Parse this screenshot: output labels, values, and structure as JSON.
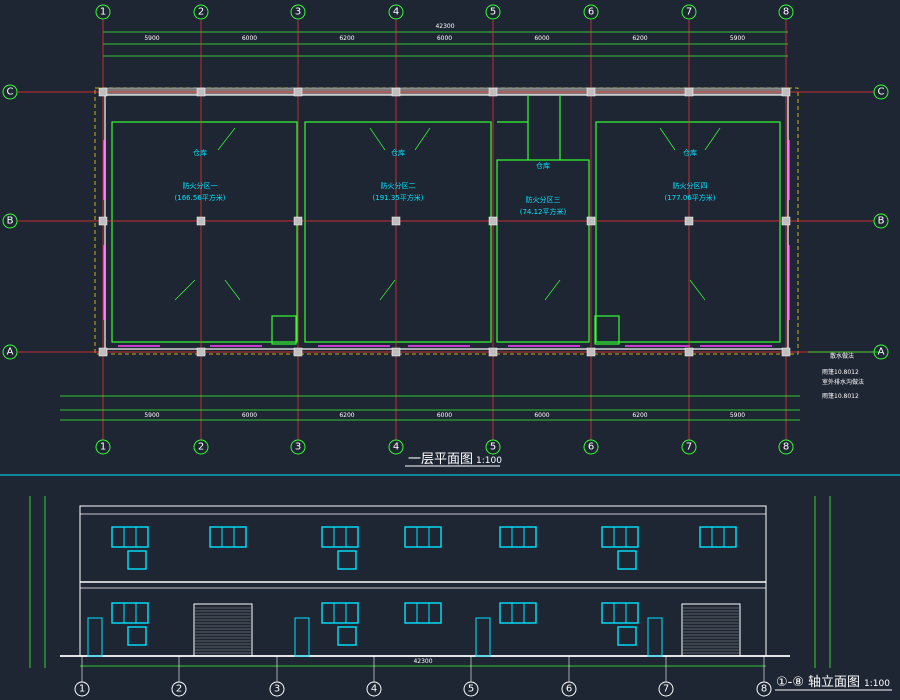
{
  "drawing": {
    "plan_title": "一层平面图",
    "plan_scale": "1:100",
    "elev_title_prefix": "①-⑧",
    "elev_title_suffix": "轴立面图",
    "elev_scale": "1:100",
    "total_width_dim": "42300"
  },
  "axes": {
    "columns": [
      "1",
      "2",
      "3",
      "4",
      "5",
      "6",
      "7",
      "8"
    ],
    "rows": [
      "C",
      "B",
      "A"
    ]
  },
  "spans": {
    "top": [
      "5900",
      "6000",
      "6200",
      "6000",
      "6000",
      "6200",
      "5900"
    ]
  },
  "zones": [
    {
      "title": "仓库",
      "area_name": "防火分区一",
      "area": "(166.56平方米)"
    },
    {
      "title": "仓库",
      "area_name": "防火分区二",
      "area": "(191.35平方米)"
    },
    {
      "title": "仓库",
      "area_name": "防火分区三",
      "area": "(74.12平方米)"
    },
    {
      "title": "仓库",
      "area_name": "防火分区四",
      "area": "(177.06平方米)"
    }
  ],
  "legend": {
    "item1": "散水做法",
    "item2": "雨篷10.8012",
    "item3": "室外排水沟做法",
    "item4": "雨篷10.8012"
  },
  "colors": {
    "background": "#1e2533",
    "wall_green": "#33ff33",
    "axis_red": "#ff3333",
    "cyan": "#00e5ff",
    "white": "#ffffff",
    "yellow": "#ffd700",
    "magenta": "#ff44ff"
  }
}
